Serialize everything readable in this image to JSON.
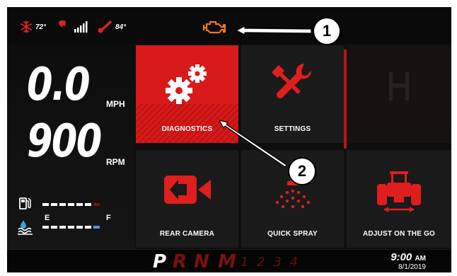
{
  "status": {
    "cab_temp": "72°",
    "fan_icon": "fan-icon",
    "signal_icon": "signal-bars-icon",
    "coolant_temp": "84°"
  },
  "gauges": {
    "speed_value": "0.0",
    "speed_unit": "MPH",
    "rpm_value": "900",
    "rpm_unit": "RPM",
    "fuel_level_fraction": 0.857,
    "def_level_fraction": 1.0,
    "def_empty_label": "E",
    "def_full_label": "F"
  },
  "tiles": {
    "diagnostics": "DIAGNOSTICS",
    "settings": "SETTINGS",
    "rear_camera": "REAR CAMERA",
    "quick_spray": "QUICK SPRAY",
    "adjust_on_the_go": "ADJUST ON THE GO"
  },
  "transmission": {
    "gears": [
      "P",
      "R",
      "N",
      "M"
    ],
    "sub_gears": "1 2 3 4",
    "selected": "P"
  },
  "clock": {
    "time": "9:00",
    "ampm": "AM",
    "date": "8/1/2019"
  },
  "callouts": {
    "one": "1",
    "two": "2"
  },
  "colors": {
    "accent_red": "#d81a1a",
    "warning_orange": "#f07818",
    "def_blue": "#3aa0e8"
  }
}
